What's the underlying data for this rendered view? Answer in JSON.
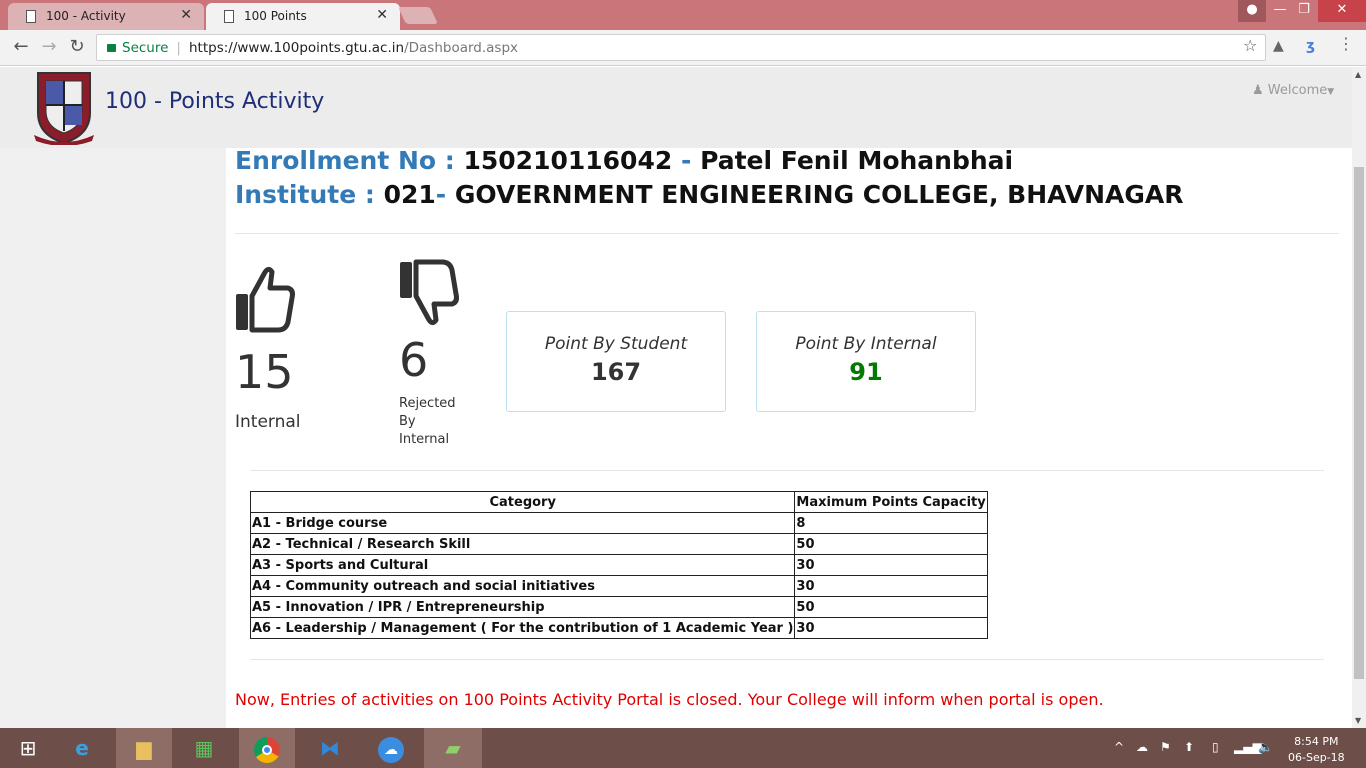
{
  "browser": {
    "tabs": [
      {
        "title": "100 - Activity"
      },
      {
        "title": "100 Points"
      }
    ],
    "address": {
      "secure_label": "Secure",
      "url_host": "https://www.100points.gtu.ac.in",
      "url_path": "/Dashboard.aspx"
    }
  },
  "header": {
    "brand": "100 - Points Activity",
    "welcome": "Welcome"
  },
  "student": {
    "enroll_label": "Enrollment No :",
    "enroll_no": "150210116042",
    "dash": "-",
    "name": "Patel Fenil Mohanbhai",
    "inst_label": "Institute :",
    "inst_code": "021",
    "inst_dash": "-",
    "inst_name": "GOVERNMENT ENGINEERING COLLEGE, BHAVNAGAR"
  },
  "stats": {
    "approved_count": "15",
    "approved_label": "Internal",
    "rejected_count": "6",
    "rejected_label_1": "Rejected",
    "rejected_label_2": "By",
    "rejected_label_3": "Internal",
    "student_points_label": "Point By Student",
    "student_points": "167",
    "internal_points_label": "Point By Internal",
    "internal_points": "91",
    "colors": {
      "internal_points": "#007a00"
    }
  },
  "table": {
    "headers": [
      "Category",
      "Maximum Points Capacity"
    ],
    "rows": [
      [
        "A1 - Bridge course",
        "8"
      ],
      [
        "A2 - Technical / Research Skill",
        "50"
      ],
      [
        "A3 - Sports and Cultural",
        "30"
      ],
      [
        "A4 - Community outreach and social initiatives",
        "30"
      ],
      [
        "A5 - Innovation / IPR / Entrepreneurship",
        "50"
      ],
      [
        "A6 - Leadership / Management ( For the contribution of 1 Academic Year )",
        "30"
      ]
    ]
  },
  "notice": "Now, Entries of activities on 100 Points Activity Portal is closed. Your College will inform when portal is open.",
  "taskbar": {
    "time": "8:54 PM",
    "date": "06-Sep-18",
    "icons": [
      "windows-start-icon",
      "ie-icon",
      "file-explorer-icon",
      "store-icon",
      "chrome-icon",
      "vscode-icon",
      "cloud-upload-icon",
      "usb-drive-icon"
    ]
  }
}
